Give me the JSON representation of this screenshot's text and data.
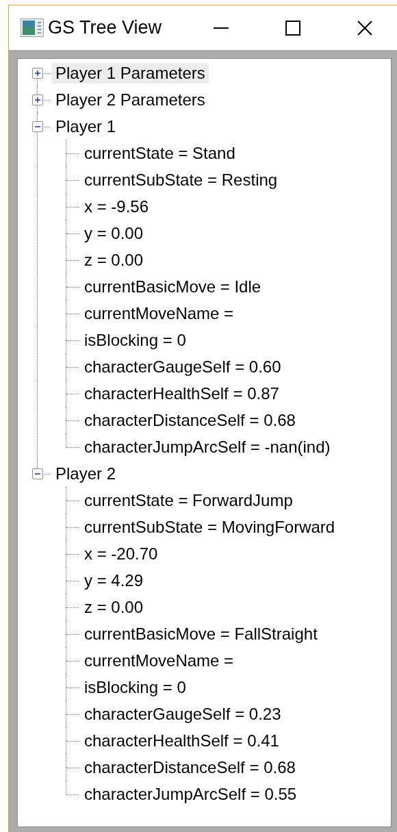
{
  "window": {
    "title": "GS Tree View"
  },
  "tree": [
    {
      "label": "Player 1 Parameters",
      "selected": true,
      "expanded": false
    },
    {
      "label": "Player 2 Parameters",
      "selected": false,
      "expanded": false
    },
    {
      "label": "Player 1",
      "selected": false,
      "expanded": true,
      "children": [
        {
          "label": "currentState = Stand",
          "selected": false
        },
        {
          "label": "currentSubState = Resting",
          "selected": false
        },
        {
          "label": "x = -9.56",
          "selected": false
        },
        {
          "label": "y = 0.00",
          "selected": false
        },
        {
          "label": "z = 0.00",
          "selected": false
        },
        {
          "label": "currentBasicMove = Idle",
          "selected": false
        },
        {
          "label": "currentMoveName =",
          "selected": false
        },
        {
          "label": "isBlocking = 0",
          "selected": false
        },
        {
          "label": "characterGaugeSelf = 0.60",
          "selected": false
        },
        {
          "label": "characterHealthSelf = 0.87",
          "selected": false
        },
        {
          "label": "characterDistanceSelf = 0.68",
          "selected": false
        },
        {
          "label": "characterJumpArcSelf = -nan(ind)",
          "selected": false
        }
      ]
    },
    {
      "label": "Player 2",
      "selected": false,
      "expanded": true,
      "children": [
        {
          "label": "currentState = ForwardJump",
          "selected": false
        },
        {
          "label": "currentSubState = MovingForward",
          "selected": false
        },
        {
          "label": "x = -20.70",
          "selected": false
        },
        {
          "label": "y = 4.29",
          "selected": false
        },
        {
          "label": "z = 0.00",
          "selected": false
        },
        {
          "label": "currentBasicMove = FallStraight",
          "selected": false
        },
        {
          "label": "currentMoveName =",
          "selected": false
        },
        {
          "label": "isBlocking = 0",
          "selected": false
        },
        {
          "label": "characterGaugeSelf = 0.23",
          "selected": false
        },
        {
          "label": "characterHealthSelf = 0.41",
          "selected": false
        },
        {
          "label": "characterDistanceSelf = 0.68",
          "selected": false
        },
        {
          "label": "characterJumpArcSelf = 0.55",
          "selected": false
        }
      ]
    }
  ]
}
